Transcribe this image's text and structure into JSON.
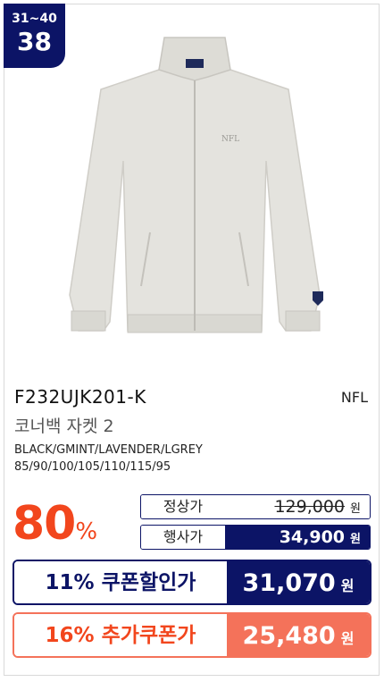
{
  "rank": {
    "range": "31~40",
    "number": "38"
  },
  "product": {
    "code": "F232UJK201-K",
    "brand": "NFL",
    "name": "코너백 자켓 2",
    "colors": "BLACK/GMINT/LAVENDER/LGREY",
    "sizes": "85/90/100/105/110/115/95",
    "image_logo": "NFL"
  },
  "discount": {
    "value": "80",
    "unit": "%"
  },
  "regular": {
    "label": "정상가",
    "price": "129,000",
    "unit": "원"
  },
  "event": {
    "label": "행사가",
    "price": "34,900",
    "unit": "원"
  },
  "coupon": {
    "percent": "11%",
    "label": "쿠폰할인가",
    "price": "31,070",
    "unit": "원"
  },
  "extra": {
    "percent": "16%",
    "label": "추가쿠폰가",
    "price": "25,480",
    "unit": "원"
  },
  "colors_theme": {
    "navy": "#0c1466",
    "orange": "#f2461d",
    "salmon": "#f4725a"
  }
}
